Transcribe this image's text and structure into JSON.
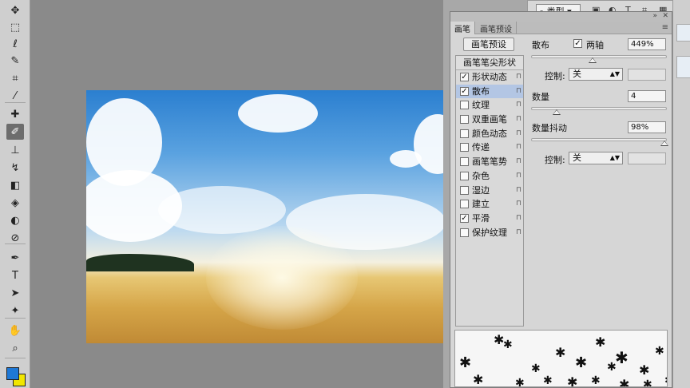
{
  "toolbar": {
    "tools": [
      {
        "name": "move-tool",
        "glyph": "✥"
      },
      {
        "name": "marquee-tool",
        "glyph": "⬚"
      },
      {
        "name": "lasso-tool",
        "glyph": "ℓ"
      },
      {
        "name": "quick-select-tool",
        "glyph": "✎"
      },
      {
        "name": "crop-tool",
        "glyph": "⌗"
      },
      {
        "name": "eyedropper-tool",
        "glyph": "⁄"
      },
      {
        "name": "healing-brush-tool",
        "glyph": "✚"
      },
      {
        "name": "brush-tool",
        "glyph": "✐"
      },
      {
        "name": "clone-stamp-tool",
        "glyph": "⊥"
      },
      {
        "name": "history-brush-tool",
        "glyph": "↯"
      },
      {
        "name": "eraser-tool",
        "glyph": "◧"
      },
      {
        "name": "paint-bucket-tool",
        "glyph": "◈"
      },
      {
        "name": "blur-tool",
        "glyph": "◐"
      },
      {
        "name": "dodge-tool",
        "glyph": "⊘"
      },
      {
        "name": "pen-tool",
        "glyph": "✒"
      },
      {
        "name": "type-tool",
        "glyph": "T"
      },
      {
        "name": "path-select-tool",
        "glyph": "➤"
      },
      {
        "name": "shape-tool",
        "glyph": "✦"
      },
      {
        "name": "hand-tool",
        "glyph": "✋"
      },
      {
        "name": "zoom-tool",
        "glyph": "⌕"
      }
    ],
    "foreground_color": "#1e78d6",
    "background_color": "#f1e600"
  },
  "layers_header": {
    "filter_label": "类型",
    "icons": [
      "image-filter-icon",
      "adjust-filter-icon",
      "type-filter-icon",
      "shape-filter-icon",
      "smart-filter-icon"
    ]
  },
  "brush_panel": {
    "tabs": [
      {
        "label": "画笔",
        "active": true
      },
      {
        "label": "画笔预设",
        "active": false
      }
    ],
    "preset_button": "画笔预设",
    "list_header": "画笔笔尖形状",
    "items": [
      {
        "label": "形状动态",
        "checked": true,
        "selected": false
      },
      {
        "label": "散布",
        "checked": true,
        "selected": true
      },
      {
        "label": "纹理",
        "checked": false,
        "selected": false
      },
      {
        "label": "双重画笔",
        "checked": false,
        "selected": false
      },
      {
        "label": "颜色动态",
        "checked": false,
        "selected": false
      },
      {
        "label": "传递",
        "checked": false,
        "selected": false
      },
      {
        "label": "画笔笔势",
        "checked": false,
        "selected": false
      },
      {
        "label": "杂色",
        "checked": false,
        "selected": false
      },
      {
        "label": "湿边",
        "checked": false,
        "selected": false
      },
      {
        "label": "建立",
        "checked": false,
        "selected": false
      },
      {
        "label": "平滑",
        "checked": true,
        "selected": false
      },
      {
        "label": "保护纹理",
        "checked": false,
        "selected": false
      }
    ],
    "scatter": {
      "label": "散布",
      "both_axes_label": "两轴",
      "both_axes_checked": true,
      "value": "449%",
      "slider_fraction": 0.45,
      "control_label": "控制:",
      "control_value": "关"
    },
    "count": {
      "label": "数量",
      "value": "4",
      "slider_fraction": 0.19
    },
    "count_jitter": {
      "label": "数量抖动",
      "value": "98%",
      "slider_fraction": 0.98,
      "control_label": "控制:",
      "control_value": "关"
    }
  }
}
